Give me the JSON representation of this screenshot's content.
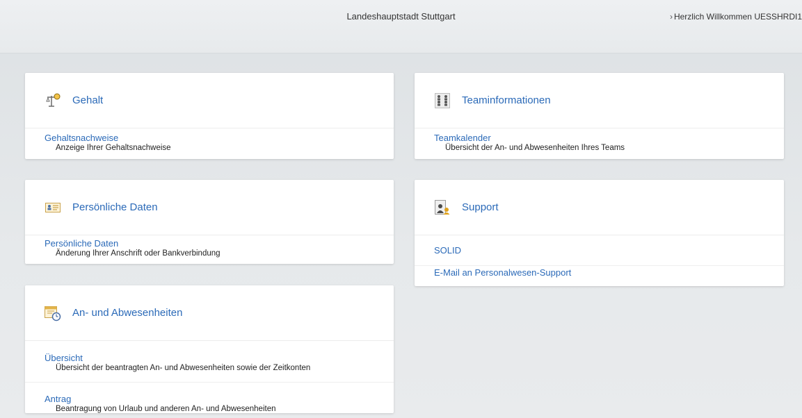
{
  "header": {
    "title": "Landeshauptstadt Stuttgart",
    "welcome": "Herzlich Willkommen UESSHRDI1"
  },
  "cards": {
    "gehalt": {
      "title": "Gehalt",
      "items": [
        {
          "label": "Gehaltsnachweise",
          "desc": "Anzeige Ihrer Gehaltsnachweise"
        }
      ]
    },
    "team": {
      "title": "Teaminformationen",
      "items": [
        {
          "label": "Teamkalender",
          "desc": "Übersicht der An- und Abwesenheiten Ihres Teams"
        }
      ]
    },
    "personal": {
      "title": "Persönliche Daten",
      "items": [
        {
          "label": "Persönliche Daten",
          "desc": "Änderung Ihrer Anschrift oder Bankverbindung"
        }
      ]
    },
    "support": {
      "title": "Support",
      "items": [
        {
          "label": "SOLID"
        },
        {
          "label": "E-Mail an Personalwesen-Support"
        }
      ]
    },
    "absence": {
      "title": "An- und Abwesenheiten",
      "items": [
        {
          "label": "Übersicht",
          "desc": "Übersicht der beantragten An- und Abwesenheiten sowie der Zeitkonten"
        },
        {
          "label": "Antrag",
          "desc": "Beantragung von Urlaub und anderen An- und Abwesenheiten"
        }
      ]
    }
  },
  "icons": {
    "gehalt": "balance-scale-icon",
    "team": "team-grid-icon",
    "personal": "id-card-icon",
    "support": "support-person-icon",
    "absence": "calendar-clock-icon"
  },
  "colors": {
    "link": "#2b6ab8",
    "background": "#e6e9eb",
    "card": "#ffffff"
  }
}
